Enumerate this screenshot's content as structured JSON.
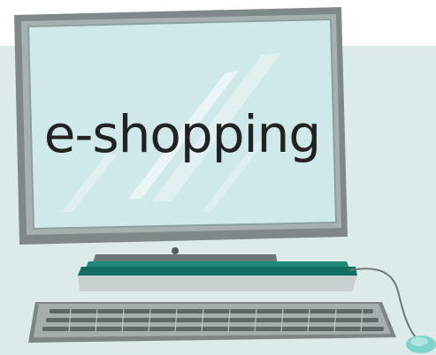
{
  "screen": {
    "text": "e-shopping"
  },
  "colors": {
    "background_band": "#dcebea",
    "monitor_frame": "#8e9696",
    "monitor_screen": "#cfe8ea",
    "base_teal": "#1f8a7a",
    "keyboard": "#9aa2a2",
    "mouse": "#7fd3cc"
  },
  "icons": {
    "monitor": "computer-monitor",
    "keyboard": "keyboard",
    "mouse": "computer-mouse"
  }
}
